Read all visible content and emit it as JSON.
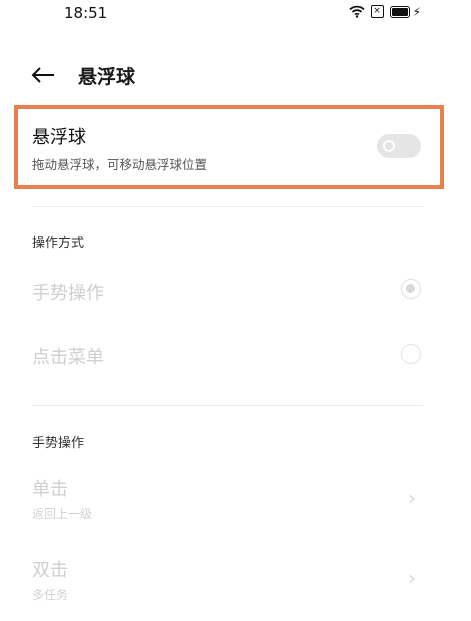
{
  "status_bar": {
    "time": "18:51",
    "icons": [
      "wifi-icon",
      "x-box-icon",
      "battery-icon",
      "charging-icon"
    ]
  },
  "header": {
    "back_icon": "arrow-left-icon",
    "title": "悬浮球"
  },
  "floating_ball": {
    "title": "悬浮球",
    "subtitle": "拖动悬浮球，可移动悬浮球位置",
    "enabled": false,
    "highlight_color": "#e8804d"
  },
  "operation_mode": {
    "header": "操作方式",
    "options": [
      {
        "label": "手势操作",
        "selected": true
      },
      {
        "label": "点击菜单",
        "selected": false
      }
    ]
  },
  "gesture_operation": {
    "header": "手势操作",
    "items": [
      {
        "label": "单击",
        "sub": "返回上一级"
      },
      {
        "label": "双击",
        "sub": "多任务"
      }
    ]
  }
}
